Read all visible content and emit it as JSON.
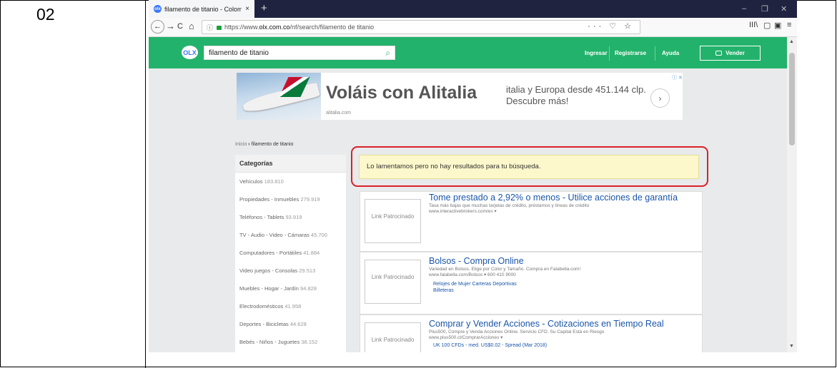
{
  "row_number": "02",
  "browser": {
    "tab_title": "filamento de titanio - Colombi",
    "tab_icon_text": "olx",
    "tab_close": "×",
    "new_tab": "+",
    "window_controls": [
      "–",
      "❐",
      "✕"
    ],
    "nav": {
      "back": "←",
      "forward": "→",
      "reload": "C",
      "home": "⌂"
    },
    "url": {
      "info": "ⓘ",
      "prefix": "https://www.",
      "host": "olx.com.co",
      "path": "/nf/search/filamento de titanio"
    },
    "url_actions": "··· ♡ ☆",
    "toolbar_right": [
      "III\\",
      "▢",
      "▣",
      "≡"
    ]
  },
  "olx": {
    "logo": "OLX",
    "search_value": "filamento de titanio",
    "search_icon": "⌕",
    "links": [
      "Ingresar",
      "Registrarse",
      "Ayuda"
    ],
    "sell_label": "Vender"
  },
  "ad": {
    "title": "Voláis con Alitalia",
    "domain": "alitalia.com",
    "text": "italia y Europa desde 451.144 clp. Descubre más!",
    "arrow": "›",
    "choice": "ⓘ ✕"
  },
  "breadcrumb": {
    "home": "Inicio",
    "separator": "›",
    "current": "filamento de titanio"
  },
  "categories": {
    "heading": "Categorías",
    "items": [
      {
        "label": "Vehículos",
        "count": "183.810"
      },
      {
        "label": "Propiedades - Inmuebles",
        "count": "279.919"
      },
      {
        "label": "Teléfonos - Tablets",
        "count": "93.919"
      },
      {
        "label": "TV - Audio - Video - Cámaras",
        "count": "45.700"
      },
      {
        "label": "Computadores - Portátiles",
        "count": "41.884"
      },
      {
        "label": "Video juegos - Consolas",
        "count": "29.513"
      },
      {
        "label": "Muebles - Hogar - Jardín",
        "count": "94.828"
      },
      {
        "label": "Electrodomésticos",
        "count": "41.958"
      },
      {
        "label": "Deportes - Bicicletas",
        "count": "44.628"
      },
      {
        "label": "Bebés - Niños - Juguetes",
        "count": "38.152"
      }
    ]
  },
  "alert_message": "Lo lamentamos pero no hay resultados para tu búsqueda.",
  "results": [
    {
      "sponsor": "Link Patrocinado",
      "title": "Tome prestado a 2,92% o menos - Utilice acciones de garantía",
      "desc": [
        "Tasa más bajas que muchas tarjetas de crédito, préstamos y líneas de crédito",
        "www.interactivebrokers.com/es ▾"
      ],
      "links": []
    },
    {
      "sponsor": "Link Patrocinado",
      "title": "Bolsos - Compra Online",
      "desc": [
        "Variedad en Bolsos. Elige por Color y Tamaño. Compra en Falabella.com!",
        "www.falabella.com/Bolsos ▾   600 410 9000"
      ],
      "links": [
        "Relojes de Mujer   Carteras Deportivas",
        "Billeteras"
      ]
    },
    {
      "sponsor": "Link Patrocinado",
      "title": "Comprar y Vender Acciones - Cotizaciones en Tiempo Real",
      "desc": [
        "Plus500, Compre y Venda Acciones Online. Servicio CFD. Su Capital Está en Riesgo",
        "www.plus500.cl/ComprarAcciones ▾"
      ],
      "links": [
        "UK 100 CFDs - med. US$0.02 - Spread (Mar 2018)"
      ]
    }
  ]
}
